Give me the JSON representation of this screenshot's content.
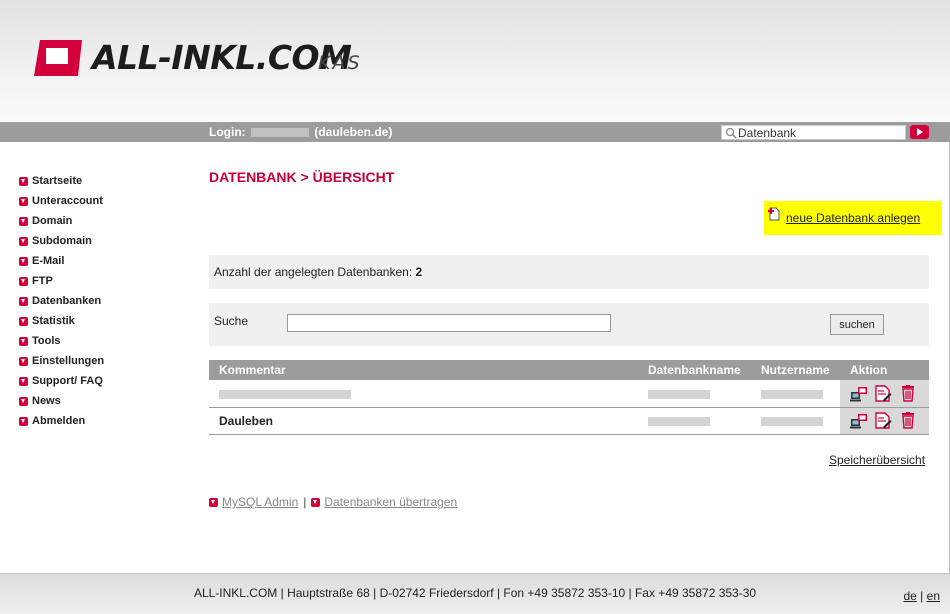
{
  "brand": {
    "name": "ALL-INKL.COM",
    "product": "KAS"
  },
  "topbar": {
    "login_label": "Login:",
    "login_domain": "(dauleben.de)",
    "search_value": "Datenbank"
  },
  "nav": {
    "items": [
      {
        "label": "Startseite"
      },
      {
        "label": "Unteraccount"
      },
      {
        "label": "Domain"
      },
      {
        "label": "Subdomain"
      },
      {
        "label": "E-Mail"
      },
      {
        "label": "FTP"
      },
      {
        "label": "Datenbanken"
      },
      {
        "label": "Statistik"
      },
      {
        "label": "Tools"
      },
      {
        "label": "Einstellungen"
      },
      {
        "label": "Support/ FAQ"
      },
      {
        "label": "News"
      },
      {
        "label": "Abmelden"
      }
    ]
  },
  "main": {
    "title": "DATENBANK > ÜBERSICHT",
    "new_db_link": "neue Datenbank anlegen",
    "count_label": "Anzahl der angelegten Datenbanken:",
    "count_value": "2",
    "search_label": "Suche",
    "search_button": "suchen",
    "table": {
      "headers": [
        "Kommentar",
        "Datenbankname",
        "Nutzername",
        "Aktion"
      ],
      "rows": [
        {
          "comment": ""
        },
        {
          "comment": "Dauleben"
        }
      ]
    },
    "storage_link": "Speicherübersicht",
    "mysql_admin_link": "MySQL Admin",
    "transfer_link": "Datenbanken übertragen",
    "separator": "|"
  },
  "footer": {
    "address": "ALL-INKL.COM | Hauptstraße 68 | D-02742 Friedersdorf | Fon +49 35872 353-10 | Fax +49 35872 353-30",
    "lang_de": "de",
    "lang_sep": "|",
    "lang_en": "en"
  },
  "colors": {
    "accent": "#d4003c",
    "title": "#c8003a",
    "bar": "#9c9c9c",
    "highlight": "#ffff00"
  }
}
